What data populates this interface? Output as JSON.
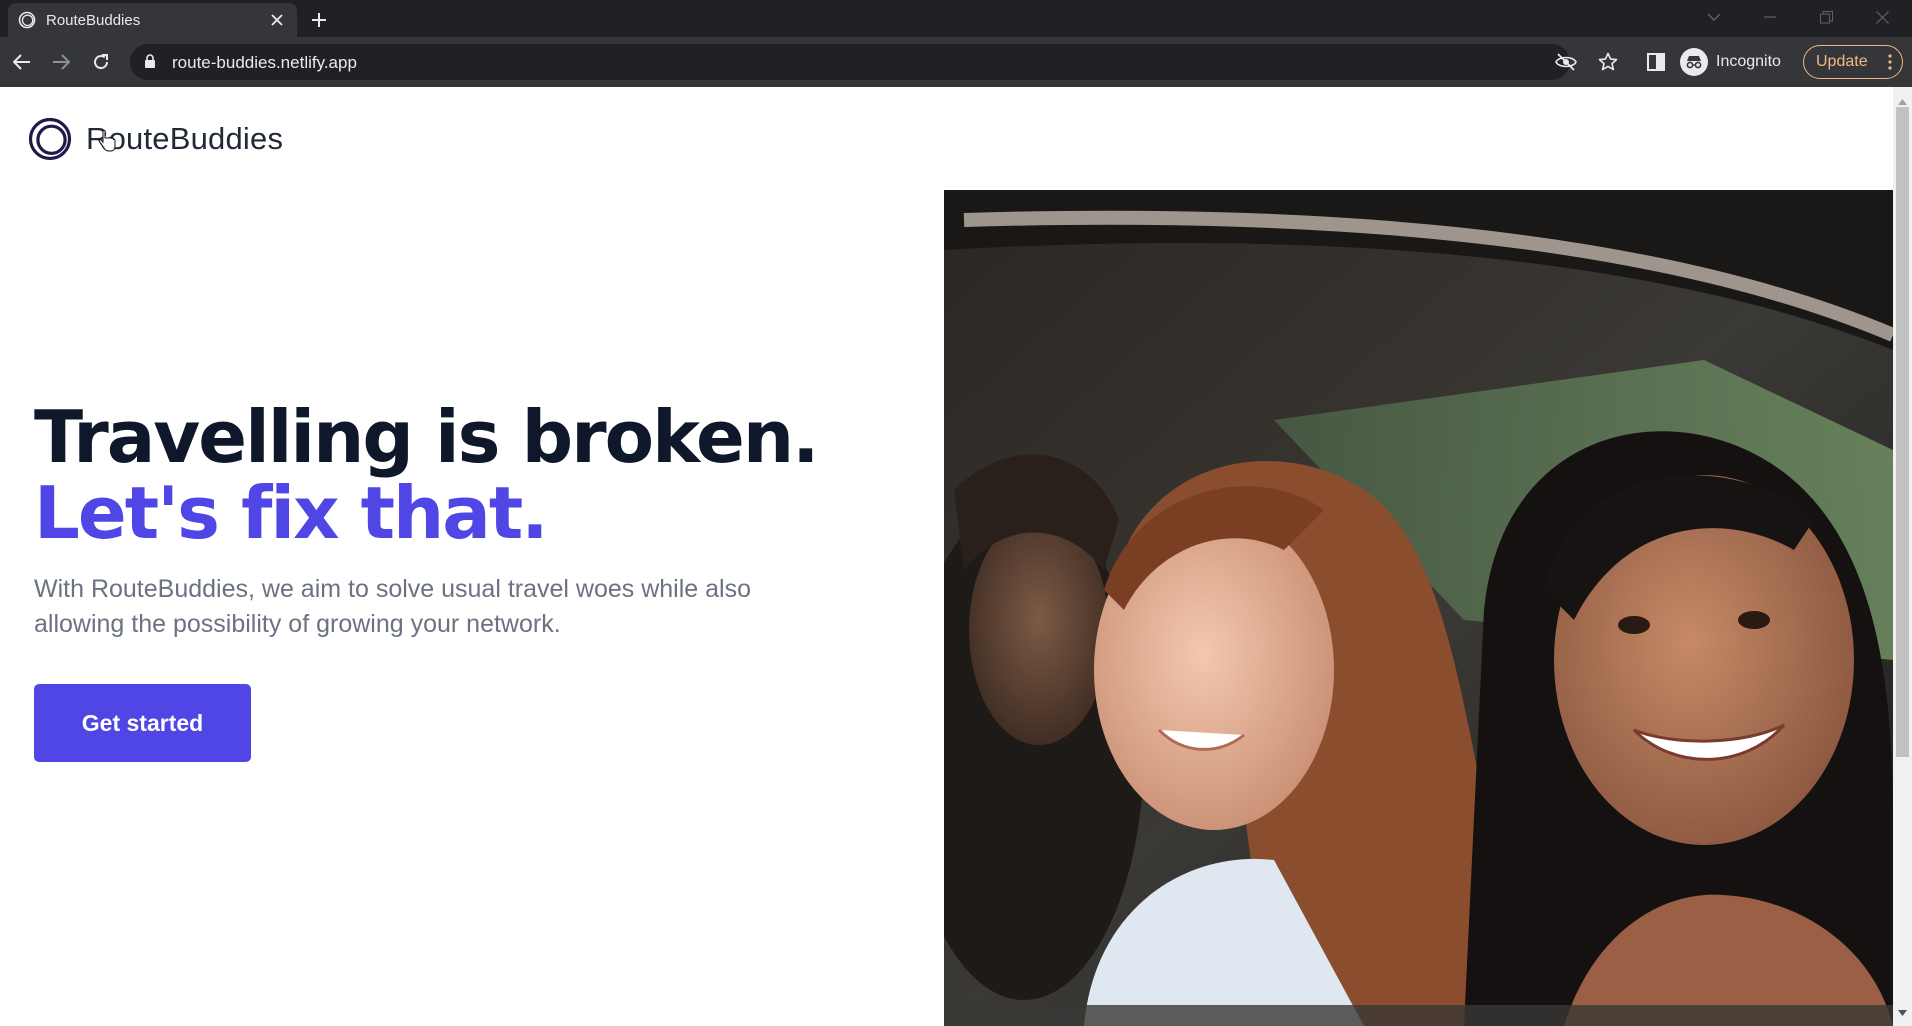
{
  "browser": {
    "tab_title": "RouteBuddies",
    "url": "route-buddies.netlify.app",
    "incognito_label": "Incognito",
    "update_label": "Update",
    "icons": [
      "favicon-ring-icon",
      "close-icon",
      "plus-icon",
      "chevron-down-icon",
      "minimize-icon",
      "restore-icon",
      "close-window-icon",
      "back-arrow-icon",
      "forward-arrow-icon",
      "reload-icon",
      "lock-icon",
      "eye-off-icon",
      "star-icon",
      "side-panel-icon",
      "incognito-icon",
      "more-vert-icon"
    ]
  },
  "site": {
    "brand_name": "RouteBuddies",
    "headline_line1": "Travelling is broken.",
    "headline_line2": "Let's fix that.",
    "description": "With RouteBuddies, we aim to solve usual travel woes while also allowing the possibility of growing your network.",
    "cta_label": "Get started"
  },
  "colors": {
    "accent": "#4f46e5",
    "headline": "#0f172a",
    "body_text": "#6b7280",
    "chrome_dark": "#202124",
    "chrome_mid": "#35363a",
    "update_orange": "#f2b880"
  }
}
